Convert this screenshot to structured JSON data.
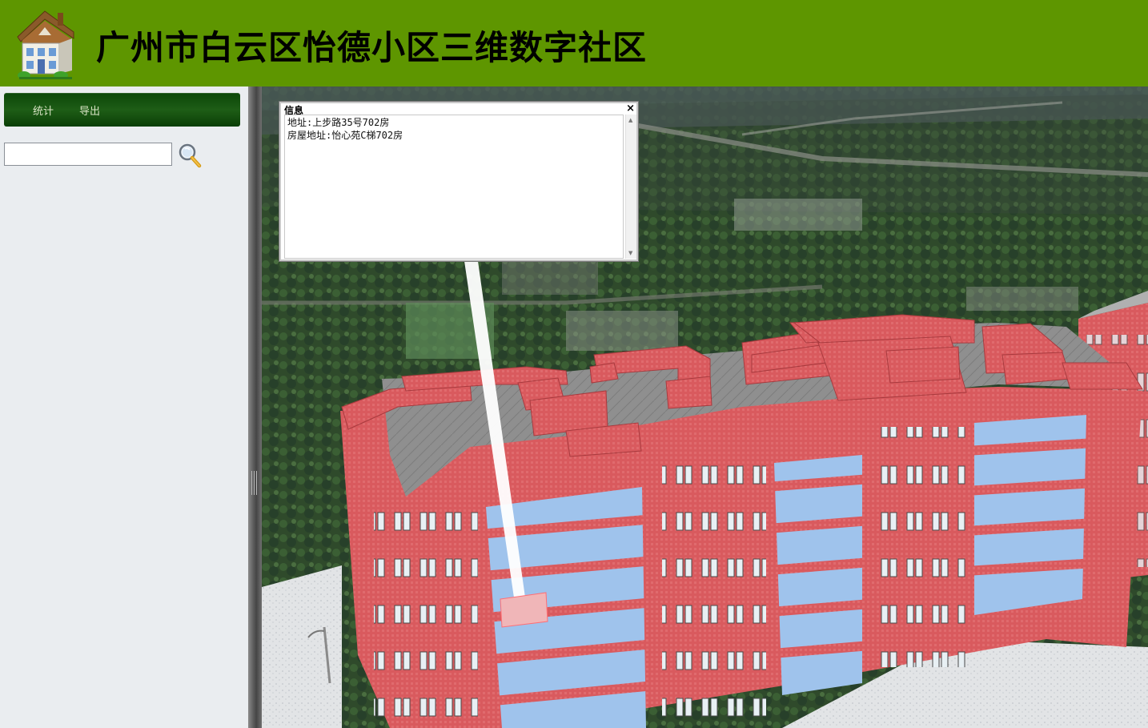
{
  "header": {
    "title": "广州市白云区怡德小区三维数字社区",
    "logo_icon": "house-icon",
    "bg_color": "#5e9600"
  },
  "nav": {
    "items": [
      {
        "label": "统计"
      },
      {
        "label": "导出"
      }
    ]
  },
  "search": {
    "value": "",
    "placeholder": "",
    "button_icon": "magnifier-icon"
  },
  "popup": {
    "title": "信息",
    "close_label": "×",
    "lines": [
      "地址:上步路35号702房",
      "房屋地址:怡心苑C梯702房"
    ]
  },
  "viewport": {
    "scene": "3d-building-satellite",
    "building_color": "#d9565b",
    "glass_color": "#9fc3ec",
    "roof_color": "#8e8e8e"
  }
}
